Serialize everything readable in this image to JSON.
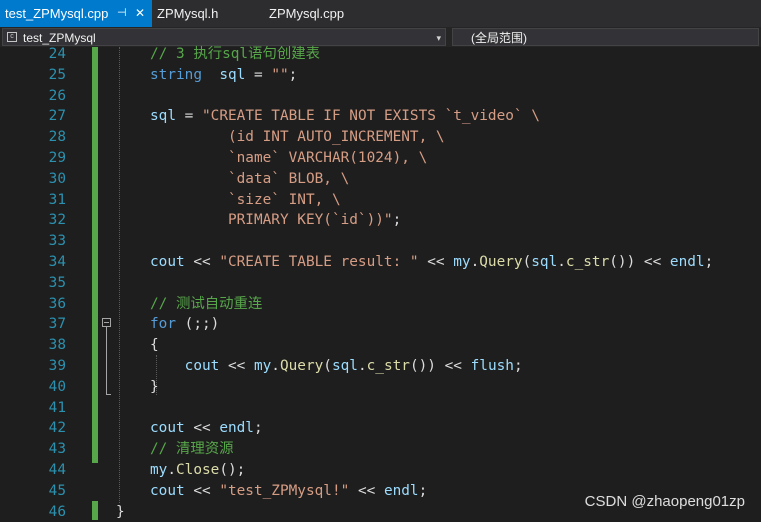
{
  "tabs": [
    {
      "label": "test_ZPMysql.cpp",
      "pin_icon": "⊣",
      "close_icon": "✕"
    },
    {
      "label": "ZPMysql.h"
    },
    {
      "label": "ZPMysql.cpp"
    }
  ],
  "nav": {
    "scope": "test_ZPMysql",
    "member": "(全局范围)",
    "dropdown": "▾"
  },
  "lines": [
    {
      "num": "24",
      "segs": [
        [
          "cm",
          "// 3 执行sql语句创建表"
        ]
      ]
    },
    {
      "num": "25",
      "segs": [
        [
          "kw",
          "string"
        ],
        [
          "",
          "  "
        ],
        [
          "id",
          "sql"
        ],
        [
          "",
          " = "
        ],
        [
          "str",
          "\"\""
        ],
        [
          "",
          ";"
        ]
      ]
    },
    {
      "num": "26",
      "segs": []
    },
    {
      "num": "27",
      "segs": [
        [
          "id",
          "sql"
        ],
        [
          "",
          " = "
        ],
        [
          "str",
          "\"CREATE TABLE IF NOT EXISTS `t_video` \\"
        ]
      ]
    },
    {
      "num": "28",
      "segs": [
        [
          "str",
          "         (id INT AUTO_INCREMENT, \\"
        ]
      ]
    },
    {
      "num": "29",
      "segs": [
        [
          "str",
          "         `name` VARCHAR(1024), \\"
        ]
      ]
    },
    {
      "num": "30",
      "segs": [
        [
          "str",
          "         `data` BLOB, \\"
        ]
      ]
    },
    {
      "num": "31",
      "segs": [
        [
          "str",
          "         `size` INT, \\"
        ]
      ]
    },
    {
      "num": "32",
      "segs": [
        [
          "str",
          "         PRIMARY KEY(`id`))\""
        ],
        [
          "",
          ";"
        ]
      ]
    },
    {
      "num": "33",
      "segs": []
    },
    {
      "num": "34",
      "segs": [
        [
          "id",
          "cout"
        ],
        [
          "",
          " << "
        ],
        [
          "str",
          "\"CREATE TABLE result: \""
        ],
        [
          "",
          " << "
        ],
        [
          "id",
          "my"
        ],
        [
          "",
          "."
        ],
        [
          "fn",
          "Query"
        ],
        [
          "",
          "("
        ],
        [
          "id",
          "sql"
        ],
        [
          "",
          "."
        ],
        [
          "fn",
          "c_str"
        ],
        [
          "",
          "()) << "
        ],
        [
          "id",
          "endl"
        ],
        [
          "",
          ";"
        ]
      ]
    },
    {
      "num": "35",
      "segs": []
    },
    {
      "num": "36",
      "segs": [
        [
          "cm",
          "// 测试自动重连"
        ]
      ]
    },
    {
      "num": "37",
      "segs": [
        [
          "kw",
          "for"
        ],
        [
          "",
          " (;;)"
        ]
      ]
    },
    {
      "num": "38",
      "segs": [
        [
          "",
          "{"
        ]
      ]
    },
    {
      "num": "39",
      "segs": [
        [
          "",
          "    "
        ],
        [
          "id",
          "cout"
        ],
        [
          "",
          " << "
        ],
        [
          "id",
          "my"
        ],
        [
          "",
          "."
        ],
        [
          "fn",
          "Query"
        ],
        [
          "",
          "("
        ],
        [
          "id",
          "sql"
        ],
        [
          "",
          "."
        ],
        [
          "fn",
          "c_str"
        ],
        [
          "",
          "()) << "
        ],
        [
          "id",
          "flush"
        ],
        [
          "",
          ";"
        ]
      ]
    },
    {
      "num": "40",
      "segs": [
        [
          "",
          "}"
        ]
      ]
    },
    {
      "num": "41",
      "segs": []
    },
    {
      "num": "42",
      "segs": [
        [
          "id",
          "cout"
        ],
        [
          "",
          " << "
        ],
        [
          "id",
          "endl"
        ],
        [
          "",
          ";"
        ]
      ]
    },
    {
      "num": "43",
      "segs": [
        [
          "cm",
          "// 清理资源"
        ]
      ]
    },
    {
      "num": "44",
      "segs": [
        [
          "id",
          "my"
        ],
        [
          "",
          "."
        ],
        [
          "fn",
          "Close"
        ],
        [
          "",
          "();"
        ]
      ]
    },
    {
      "num": "45",
      "segs": [
        [
          "id",
          "cout"
        ],
        [
          "",
          " << "
        ],
        [
          "str",
          "\"test_ZPMysql!\""
        ],
        [
          "",
          " << "
        ],
        [
          "id",
          "endl"
        ],
        [
          "",
          ";"
        ]
      ]
    },
    {
      "num": "46",
      "segs": [
        [
          "",
          "}"
        ]
      ]
    }
  ],
  "watermark": "CSDN @zhaopeng01zp",
  "colors": {
    "background": "#1e1e1e",
    "line_number": "#2b91af",
    "keyword": "#569cd6",
    "string": "#d69d85",
    "comment": "#57a64a",
    "identifier": "#9cdcfe",
    "function": "#dcdcaa",
    "active_tab": "#007acc",
    "change_bar": "#57a64a"
  }
}
